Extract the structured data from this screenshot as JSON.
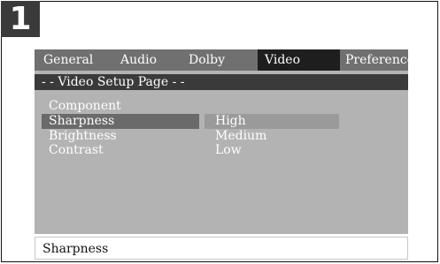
{
  "badge": {
    "number": "1"
  },
  "tabs": [
    {
      "label": "General",
      "active": false
    },
    {
      "label": "Audio",
      "active": false
    },
    {
      "label": "Dolby",
      "active": false
    },
    {
      "label": "Video",
      "active": true
    },
    {
      "label": "Preference",
      "active": false
    }
  ],
  "page": {
    "title": "- - Video Setup Page - -"
  },
  "menu": {
    "items": [
      "Component",
      "Sharpness",
      "Brightness",
      "Contrast"
    ],
    "selected": "Sharpness"
  },
  "options": {
    "items": [
      "High",
      "Medium",
      "Low"
    ],
    "selected": "High"
  },
  "status": {
    "text": "Sharpness"
  }
}
